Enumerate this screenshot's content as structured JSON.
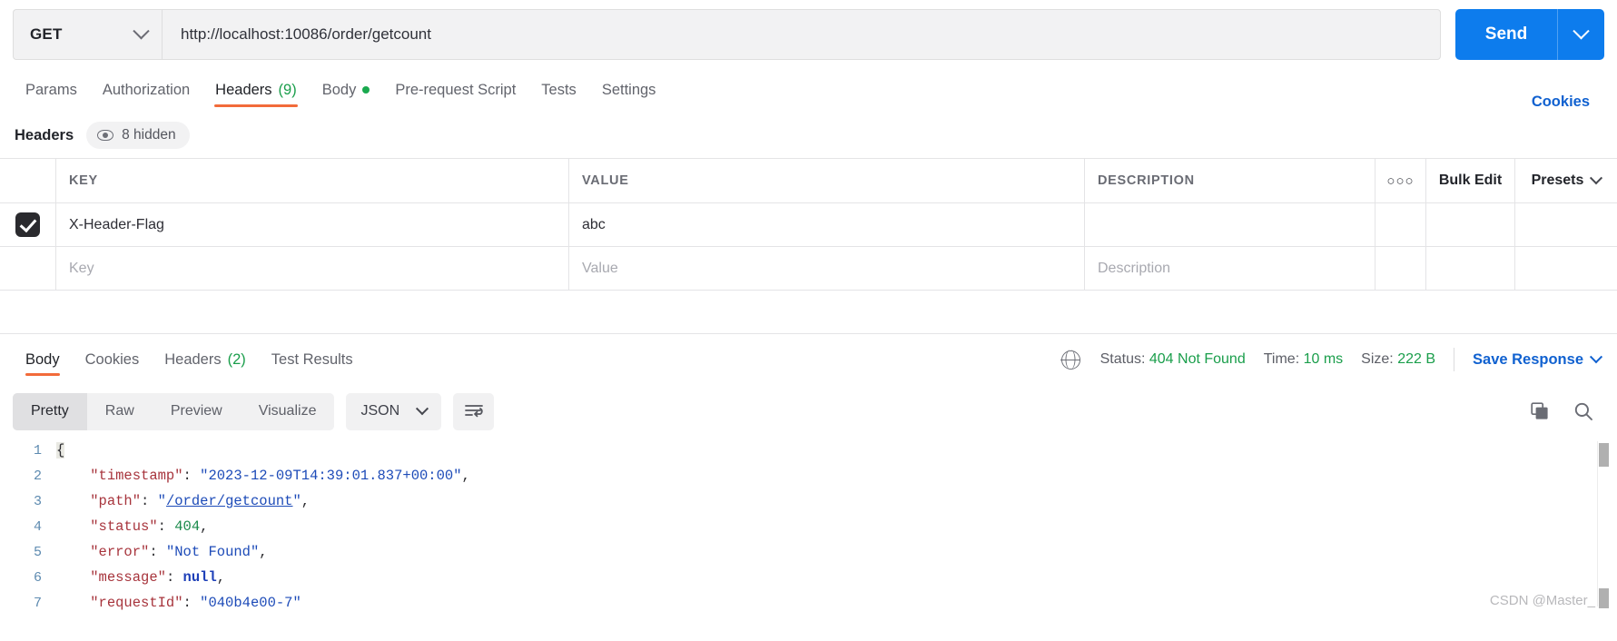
{
  "request": {
    "method": "GET",
    "url": "http://localhost:10086/order/getcount",
    "send_label": "Send",
    "tabs": [
      {
        "label": "Params",
        "count": "",
        "active": false,
        "dot": false
      },
      {
        "label": "Authorization",
        "count": "",
        "active": false,
        "dot": false
      },
      {
        "label": "Headers",
        "count": "(9)",
        "active": true,
        "dot": false
      },
      {
        "label": "Body",
        "count": "",
        "active": false,
        "dot": true
      },
      {
        "label": "Pre-request Script",
        "count": "",
        "active": false,
        "dot": false
      },
      {
        "label": "Tests",
        "count": "",
        "active": false,
        "dot": false
      },
      {
        "label": "Settings",
        "count": "",
        "active": false,
        "dot": false
      }
    ],
    "cookies_link": "Cookies"
  },
  "headers_panel": {
    "label": "Headers",
    "hidden_pill": "8 hidden",
    "columns": {
      "key": "KEY",
      "value": "VALUE",
      "description": "DESCRIPTION"
    },
    "actions": {
      "more": "○○○",
      "bulk_edit": "Bulk Edit",
      "presets": "Presets"
    },
    "rows": [
      {
        "checked": true,
        "key": "X-Header-Flag",
        "value": "abc",
        "description": ""
      }
    ],
    "placeholders": {
      "key": "Key",
      "value": "Value",
      "description": "Description"
    }
  },
  "response": {
    "tabs": [
      {
        "label": "Body",
        "count": "",
        "active": true
      },
      {
        "label": "Cookies",
        "count": "",
        "active": false
      },
      {
        "label": "Headers",
        "count": "(2)",
        "active": false
      },
      {
        "label": "Test Results",
        "count": "",
        "active": false
      }
    ],
    "status_label": "Status:",
    "status_value": "404 Not Found",
    "time_label": "Time:",
    "time_value": "10 ms",
    "size_label": "Size:",
    "size_value": "222 B",
    "save_response": "Save Response",
    "view_modes": [
      {
        "label": "Pretty",
        "active": true
      },
      {
        "label": "Raw",
        "active": false
      },
      {
        "label": "Preview",
        "active": false
      },
      {
        "label": "Visualize",
        "active": false
      }
    ],
    "format": "JSON",
    "body_lines": [
      {
        "num": "1",
        "tokens": [
          {
            "t": "{",
            "c": "brace-hl p"
          }
        ]
      },
      {
        "num": "2",
        "tokens": [
          {
            "t": "    ",
            "c": "p"
          },
          {
            "t": "\"timestamp\"",
            "c": "k"
          },
          {
            "t": ": ",
            "c": "p"
          },
          {
            "t": "\"2023-12-09T14:39:01.837+00:00\"",
            "c": "s"
          },
          {
            "t": ",",
            "c": "p"
          }
        ]
      },
      {
        "num": "3",
        "tokens": [
          {
            "t": "    ",
            "c": "p"
          },
          {
            "t": "\"path\"",
            "c": "k"
          },
          {
            "t": ": ",
            "c": "p"
          },
          {
            "t": "\"",
            "c": "s"
          },
          {
            "t": "/order/getcount",
            "c": "lnk"
          },
          {
            "t": "\"",
            "c": "s"
          },
          {
            "t": ",",
            "c": "p"
          }
        ]
      },
      {
        "num": "4",
        "tokens": [
          {
            "t": "    ",
            "c": "p"
          },
          {
            "t": "\"status\"",
            "c": "k"
          },
          {
            "t": ": ",
            "c": "p"
          },
          {
            "t": "404",
            "c": "n"
          },
          {
            "t": ",",
            "c": "p"
          }
        ]
      },
      {
        "num": "5",
        "tokens": [
          {
            "t": "    ",
            "c": "p"
          },
          {
            "t": "\"error\"",
            "c": "k"
          },
          {
            "t": ": ",
            "c": "p"
          },
          {
            "t": "\"Not Found\"",
            "c": "s"
          },
          {
            "t": ",",
            "c": "p"
          }
        ]
      },
      {
        "num": "6",
        "tokens": [
          {
            "t": "    ",
            "c": "p"
          },
          {
            "t": "\"message\"",
            "c": "k"
          },
          {
            "t": ": ",
            "c": "p"
          },
          {
            "t": "null",
            "c": "nl"
          },
          {
            "t": ",",
            "c": "p"
          }
        ]
      },
      {
        "num": "7",
        "tokens": [
          {
            "t": "    ",
            "c": "p"
          },
          {
            "t": "\"requestId\"",
            "c": "k"
          },
          {
            "t": ": ",
            "c": "p"
          },
          {
            "t": "\"040b4e00-7\"",
            "c": "s"
          }
        ]
      }
    ]
  },
  "watermark": "CSDN @Master_"
}
